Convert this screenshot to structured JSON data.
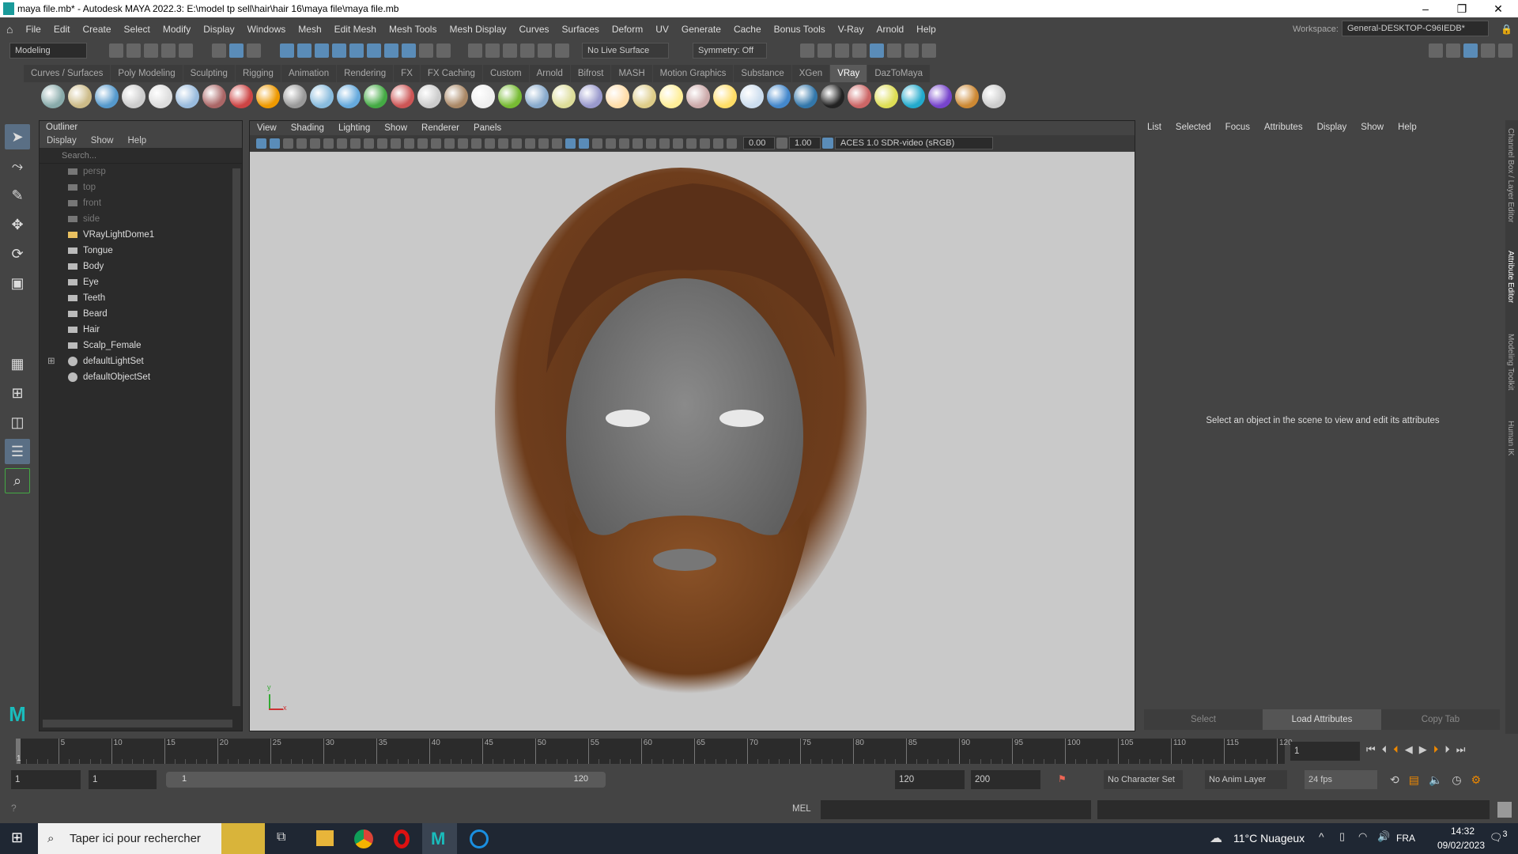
{
  "window": {
    "title": "maya file.mb* - Autodesk MAYA 2022.3: E:\\model tp sell\\hair\\hair 16\\maya file\\maya file.mb",
    "minimize": "–",
    "maximize": "❐",
    "close": "✕"
  },
  "menu": [
    "File",
    "Edit",
    "Create",
    "Select",
    "Modify",
    "Display",
    "Windows",
    "Mesh",
    "Edit Mesh",
    "Mesh Tools",
    "Mesh Display",
    "Curves",
    "Surfaces",
    "Deform",
    "UV",
    "Generate",
    "Cache",
    "Bonus Tools",
    "V-Ray",
    "Arnold",
    "Help"
  ],
  "workspace": {
    "label": "Workspace:",
    "value": "General-DESKTOP-C96IEDB*"
  },
  "status": {
    "mode": "Modeling",
    "live_surface": "No Live Surface",
    "symmetry": "Symmetry: Off"
  },
  "shelf_tabs": [
    "Curves / Surfaces",
    "Poly Modeling",
    "Sculpting",
    "Rigging",
    "Animation",
    "Rendering",
    "FX",
    "FX Caching",
    "Custom",
    "Arnold",
    "Bifrost",
    "MASH",
    "Motion Graphics",
    "Substance",
    "XGen",
    "VRay",
    "DazToMaya"
  ],
  "active_shelf": "VRay",
  "outliner": {
    "title": "Outliner",
    "menu": [
      "Display",
      "Show",
      "Help"
    ],
    "search_placeholder": "Search...",
    "items": [
      {
        "name": "persp",
        "dim": true
      },
      {
        "name": "top",
        "dim": true
      },
      {
        "name": "front",
        "dim": true
      },
      {
        "name": "side",
        "dim": true
      },
      {
        "name": "VRayLightDome1"
      },
      {
        "name": "Tongue"
      },
      {
        "name": "Body"
      },
      {
        "name": "Eye"
      },
      {
        "name": "Teeth"
      },
      {
        "name": "Beard"
      },
      {
        "name": "Hair"
      },
      {
        "name": "Scalp_Female"
      },
      {
        "name": "defaultLightSet",
        "expand": "⊞"
      },
      {
        "name": "defaultObjectSet"
      }
    ]
  },
  "viewport": {
    "menu": [
      "View",
      "Shading",
      "Lighting",
      "Show",
      "Renderer",
      "Panels"
    ],
    "exposure": "0.00",
    "gamma": "1.00",
    "colorspace": "ACES 1.0 SDR-video (sRGB)",
    "axis_y": "y",
    "axis_x": "x"
  },
  "attribute_editor": {
    "menu": [
      "List",
      "Selected",
      "Focus",
      "Attributes",
      "Display",
      "Show",
      "Help"
    ],
    "message": "Select an object in the scene to view and edit its attributes",
    "buttons": [
      "Select",
      "Load Attributes",
      "Copy Tab"
    ]
  },
  "right_tabs": [
    "Channel Box / Layer Editor",
    "Attribute Editor",
    "Modeling Toolkit",
    "Human IK"
  ],
  "timeline": {
    "ticks": [
      5,
      10,
      15,
      20,
      25,
      30,
      35,
      40,
      45,
      50,
      55,
      60,
      65,
      70,
      75,
      80,
      85,
      90,
      95,
      100,
      105,
      110,
      115,
      120
    ],
    "current_frame": "1",
    "frame_field": "1"
  },
  "range": {
    "start": "1",
    "playback_start": "1",
    "slider_start": "1",
    "slider_end": "120",
    "playback_end": "120",
    "end": "200",
    "character_set": "No Character Set",
    "anim_layer": "No Anim Layer",
    "fps": "24 fps"
  },
  "cmd": {
    "lang": "MEL"
  },
  "taskbar": {
    "search": "Taper ici pour rechercher",
    "weather": "11°C  Nuageux",
    "lang": "FRA",
    "time": "14:32",
    "date": "09/02/2023",
    "notifications": "3"
  }
}
